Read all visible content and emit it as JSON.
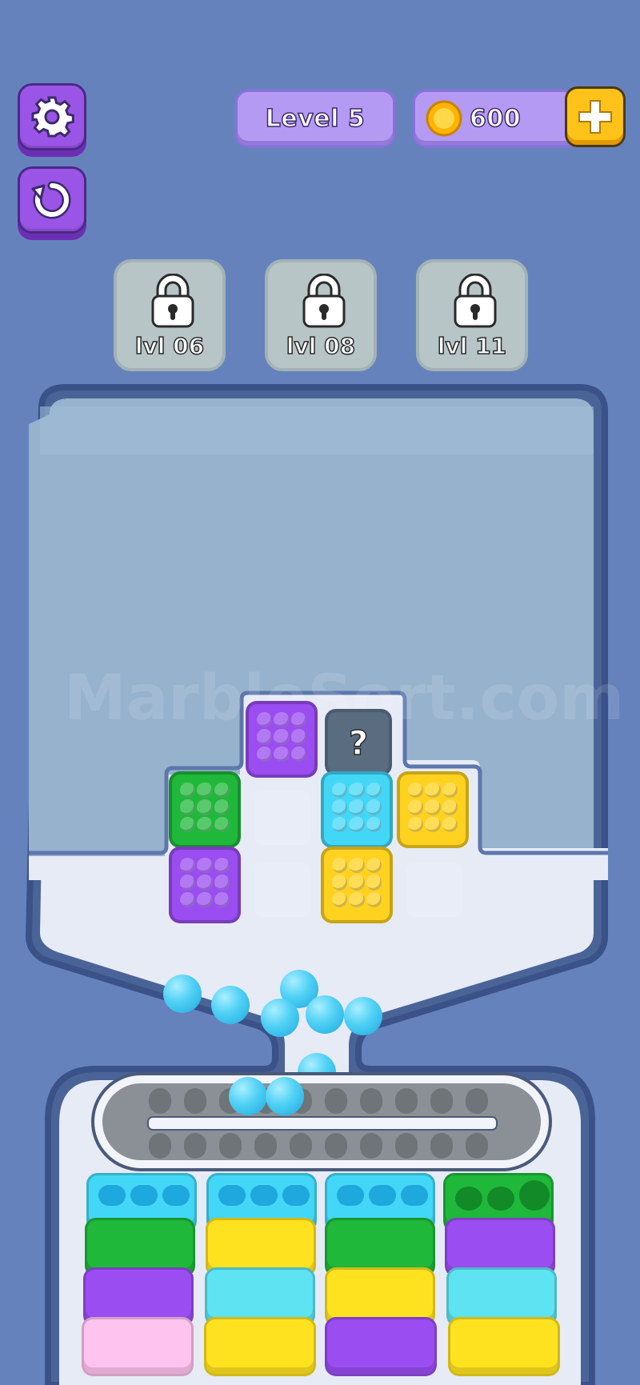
{
  "hud": {
    "level_label": "Level 5",
    "coins": "600",
    "settings_icon": "gear-icon",
    "restart_icon": "restart-icon",
    "add_icon": "plus-icon",
    "coin_icon": "coin-icon"
  },
  "locked_slots": [
    {
      "label": "lvl 06"
    },
    {
      "label": "lvl 08"
    },
    {
      "label": "lvl 11"
    }
  ],
  "watermark": "MarbleSort.com",
  "grid": {
    "mystery_label": "?",
    "blocks": [
      {
        "color": "purple"
      },
      {
        "color": "hidden"
      },
      {
        "color": "green"
      },
      {
        "color": "empty"
      },
      {
        "color": "cyan"
      },
      {
        "color": "yellow"
      },
      {
        "color": "purple"
      },
      {
        "color": "empty"
      },
      {
        "color": "yellow"
      },
      {
        "color": "empty"
      }
    ]
  },
  "colors": {
    "background": "#6682bd",
    "purple": "#9a4df0",
    "green": "#1fb83a",
    "cyan": "#43d7f7",
    "yellow": "#ffd21f",
    "pink": "#ffc3f0",
    "gold": "#ffc21a"
  },
  "columns": [
    {
      "stack": [
        "cyan",
        "green",
        "purple",
        "pink"
      ]
    },
    {
      "stack": [
        "cyan",
        "yellow",
        "cyan",
        "yellow"
      ]
    },
    {
      "stack": [
        "cyan",
        "green",
        "yellow",
        "purple"
      ]
    },
    {
      "stack": [
        "green",
        "purple",
        "cyan",
        "yellow"
      ]
    }
  ]
}
